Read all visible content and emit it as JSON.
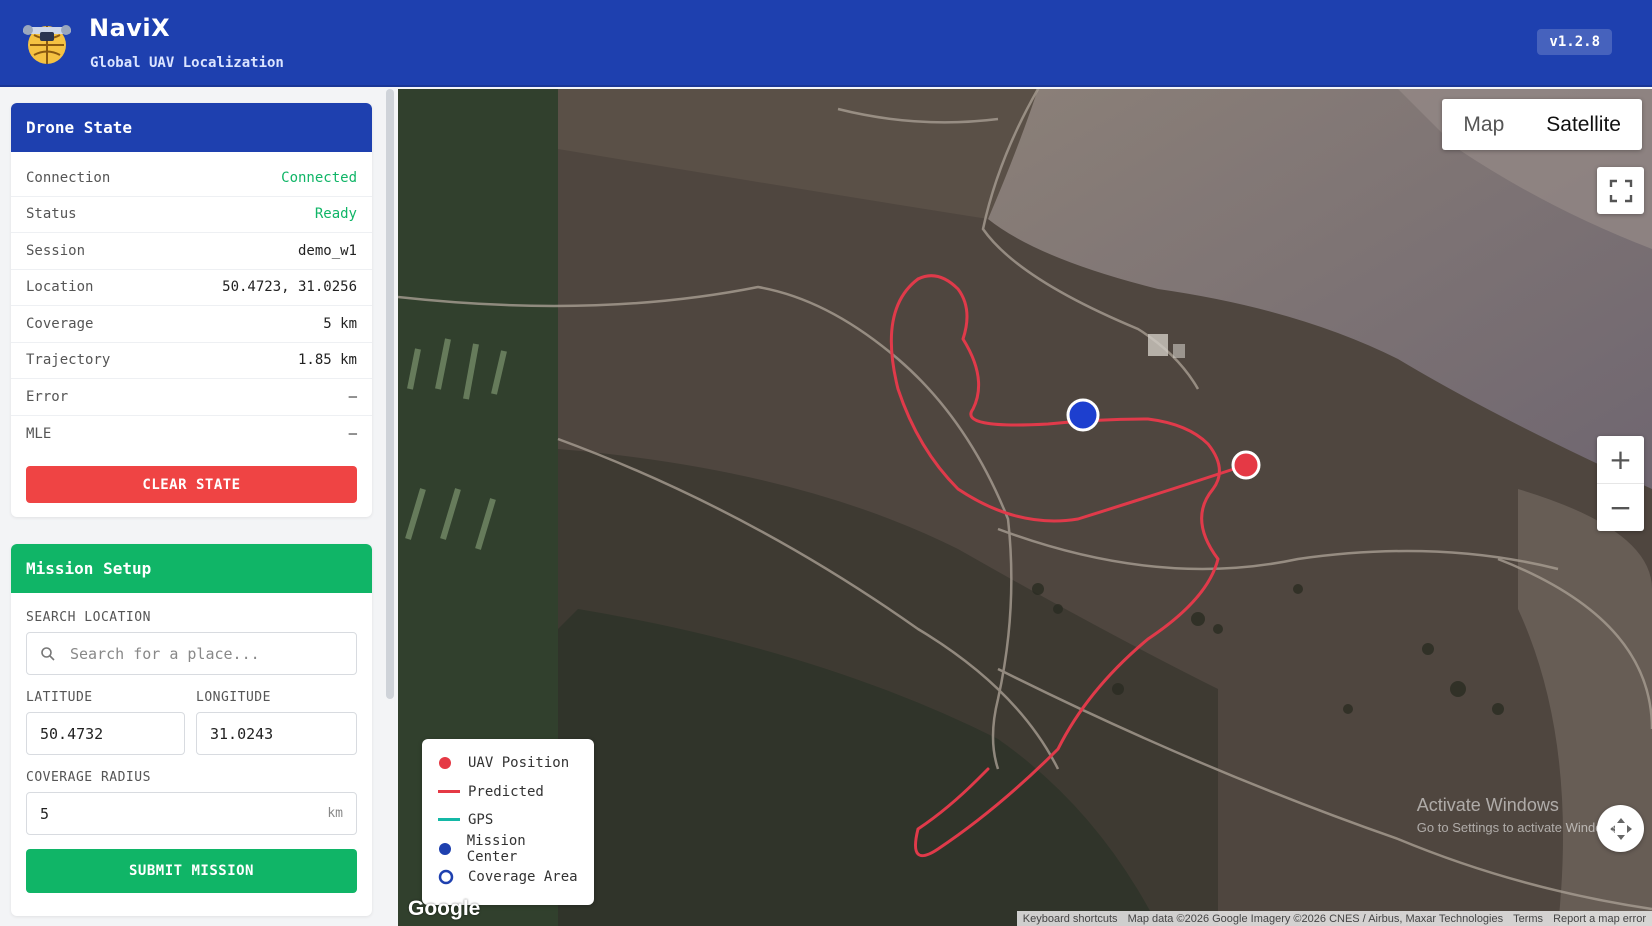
{
  "header": {
    "title": "NaviX",
    "subtitle": "Global UAV Localization",
    "version": "v1.2.8"
  },
  "drone_state": {
    "title": "Drone State",
    "rows": [
      {
        "label": "Connection",
        "value": "Connected"
      },
      {
        "label": "Status",
        "value": "Ready"
      },
      {
        "label": "Session",
        "value": "demo_w1"
      },
      {
        "label": "Location",
        "value": "50.4723, 31.0256"
      },
      {
        "label": "Coverage",
        "value": "5 km"
      },
      {
        "label": "Trajectory",
        "value": "1.85 km"
      },
      {
        "label": "Error",
        "value": "—"
      },
      {
        "label": "MLE",
        "value": "—"
      }
    ],
    "clear_button": "CLEAR STATE"
  },
  "mission_setup": {
    "title": "Mission Setup",
    "search_label": "SEARCH LOCATION",
    "search_placeholder": "Search for a place...",
    "latitude_label": "LATITUDE",
    "latitude_value": "50.4732",
    "longitude_label": "LONGITUDE",
    "longitude_value": "31.0243",
    "radius_label": "COVERAGE RADIUS",
    "radius_value": "5",
    "radius_unit": "km",
    "submit_button": "SUBMIT MISSION"
  },
  "map": {
    "type_options": [
      "Map",
      "Satellite"
    ],
    "active_type": "Satellite",
    "zoom_in": "+",
    "zoom_out": "−",
    "legend": [
      {
        "label": "UAV Position",
        "icon": "red-dot",
        "color": "#e53945"
      },
      {
        "label": "Predicted",
        "icon": "red-line",
        "color": "#e53945"
      },
      {
        "label": "GPS",
        "icon": "teal-line",
        "color": "#14b8a6"
      },
      {
        "label": "Mission Center",
        "icon": "blue-dot",
        "color": "#1e40af"
      },
      {
        "label": "Coverage Area",
        "icon": "blue-ring",
        "color": "#1e40af"
      }
    ],
    "brand": "Google",
    "attribution": [
      "Keyboard shortcuts",
      "Map data ©2026 Google Imagery ©2026 CNES / Airbus, Maxar Technologies",
      "Terms",
      "Report a map error"
    ]
  },
  "os_watermark": {
    "line1": "Activate Windows",
    "line2": "Go to Settings to activate Windows."
  },
  "colors": {
    "header_bg": "#1e40af",
    "accent_green": "#10b567",
    "danger_red": "#ef4444",
    "track_red": "#e53945"
  }
}
